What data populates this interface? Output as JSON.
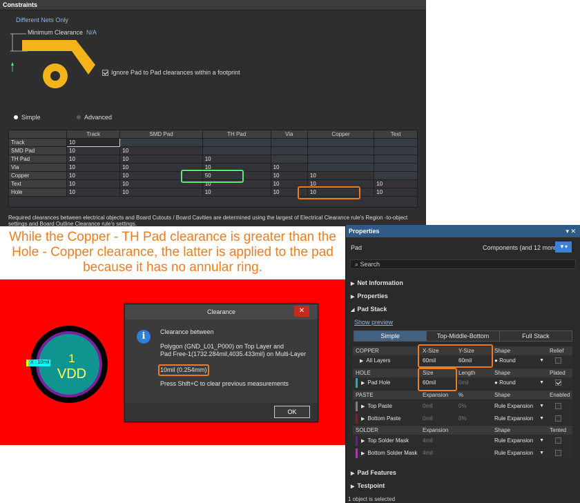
{
  "constraints": {
    "title": "Constraints",
    "different_nets": "Different Nets Only",
    "min_clearance_label": "Minimum Clearance",
    "min_clearance_value": "N/A",
    "ignore_label": "Ignore Pad to Pad clearances within a footprint",
    "mode_simple": "Simple",
    "mode_advanced": "Advanced",
    "columns": [
      "Track",
      "SMD Pad",
      "TH Pad",
      "Via",
      "Copper",
      "Text"
    ],
    "rows": [
      {
        "label": "Track",
        "cells": [
          "10",
          "",
          "",
          "",
          "",
          ""
        ]
      },
      {
        "label": "SMD Pad",
        "cells": [
          "10",
          "10",
          "",
          "",
          "",
          ""
        ]
      },
      {
        "label": "TH Pad",
        "cells": [
          "10",
          "10",
          "10",
          "",
          "",
          ""
        ]
      },
      {
        "label": "Via",
        "cells": [
          "10",
          "10",
          "10",
          "10",
          "",
          ""
        ]
      },
      {
        "label": "Copper",
        "cells": [
          "10",
          "10",
          "50",
          "10",
          "10",
          ""
        ]
      },
      {
        "label": "Text",
        "cells": [
          "10",
          "10",
          "10",
          "10",
          "10",
          "10"
        ]
      },
      {
        "label": "Hole",
        "cells": [
          "10",
          "10",
          "10",
          "10",
          "10",
          "10"
        ]
      }
    ],
    "note": "Required clearances between electrical objects and Board Cutouts / Board Cavities are determined using the largest of Electrical Clearance rule's Region -to-object settings and Board Outline Clearance rule's settings."
  },
  "caption": "While the Copper - TH Pad clearance is greater than the Hole - Copper clearance, the latter is applied to the pad because it has no annular ring.",
  "canvas": {
    "pad_number": "1",
    "pad_net": "VDD",
    "measure_label": "X : 10mil"
  },
  "dialog": {
    "title": "Clearance",
    "close": "✕",
    "line1": "Clearance between",
    "line2": "Polygon  (GND_L01_P000) on Top Layer and",
    "line3": "Pad Free-1(1732.284mil,4035.433mil) on Multi-Layer",
    "value": "10mil (0.254mm)",
    "hint": "Press Shift+C to clear previous measurements",
    "ok": "OK"
  },
  "properties": {
    "title": "Properties",
    "title_controls": "▾ ✕",
    "object": "Pad",
    "filter_text": "Components (and 12 more)",
    "search_placeholder": "Search",
    "sections": {
      "net_info": "Net Information",
      "properties": "Properties",
      "pad_stack": "Pad Stack",
      "pad_features": "Pad Features",
      "testpoint": "Testpoint"
    },
    "show_preview": "Show preview",
    "tabs": [
      "Simple",
      "Top-Middle-Bottom",
      "Full Stack"
    ],
    "copper": {
      "h1": "COPPER",
      "h2": "X-Size",
      "h3": "Y-Size",
      "h4": "Shape",
      "h5": "Relief",
      "name": "All Layers",
      "x": "60mil",
      "y": "60mil",
      "shape": "Round"
    },
    "hole": {
      "h1": "HOLE",
      "h2": "Size",
      "h3": "Length",
      "h4": "Shape",
      "h5": "Plated",
      "name": "Pad Hole",
      "size": "60mil",
      "length": "0mil",
      "shape": "Round"
    },
    "paste": {
      "h1": "PASTE",
      "h2": "Expansion",
      "h3": "%",
      "h4": "Shape",
      "h5": "Enabled",
      "rows": [
        {
          "name": "Top Paste",
          "exp": "0mil",
          "pct": "0%",
          "shape": "Rule Expansion"
        },
        {
          "name": "Bottom Paste",
          "exp": "0mil",
          "pct": "0%",
          "shape": "Rule Expansion"
        }
      ]
    },
    "solder": {
      "h1": "SOLDER",
      "h2": "Expansion",
      "h4": "Shape",
      "h5": "Tented",
      "rows": [
        {
          "name": "Top Solder Mask",
          "exp": "4mil",
          "shape": "Rule Expansion"
        },
        {
          "name": "Bottom Solder Mask",
          "exp": "4mil",
          "shape": "Rule Expansion"
        }
      ]
    },
    "status": "1 object is selected"
  }
}
